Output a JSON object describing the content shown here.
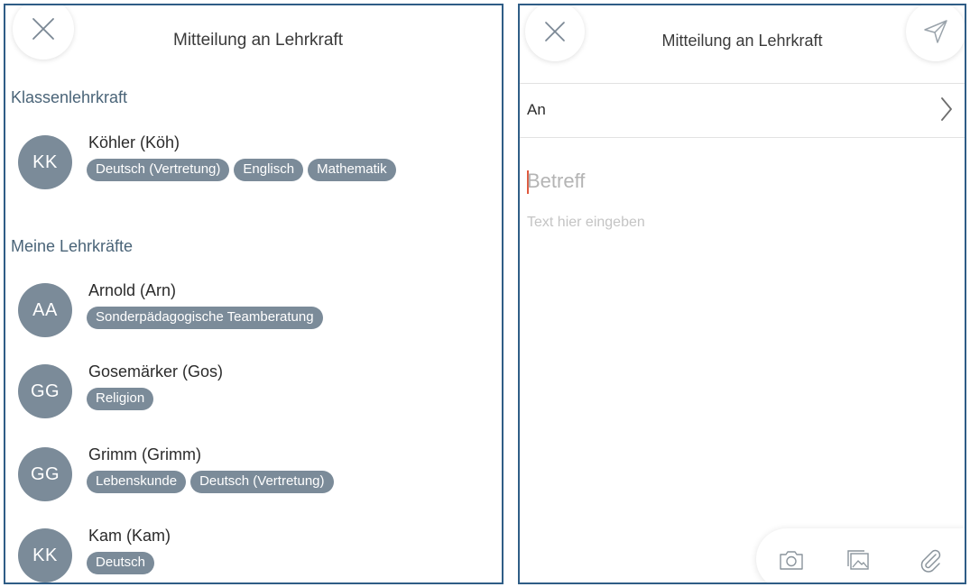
{
  "left": {
    "header": {
      "title": "Mitteilung an Lehrkraft",
      "close_icon": "close-icon"
    },
    "class_teacher_section": {
      "heading": "Klassenlehrkraft",
      "teachers": [
        {
          "initials": "KK",
          "name": "Köhler (Köh)",
          "subjects": [
            "Deutsch (Vertretung)",
            "Englisch",
            "Mathematik"
          ]
        }
      ]
    },
    "my_teachers_section": {
      "heading": "Meine Lehrkräfte",
      "teachers": [
        {
          "initials": "AA",
          "name": "Arnold (Arn)",
          "subjects": [
            "Sonderpädagogische Teamberatung"
          ]
        },
        {
          "initials": "GG",
          "name": "Gosemärker (Gos)",
          "subjects": [
            "Religion"
          ]
        },
        {
          "initials": "GG",
          "name": "Grimm (Grimm)",
          "subjects": [
            "Lebenskunde",
            "Deutsch (Vertretung)"
          ]
        },
        {
          "initials": "KK",
          "name": "Kam (Kam)",
          "subjects": [
            "Deutsch"
          ]
        }
      ]
    }
  },
  "right": {
    "header": {
      "title": "Mitteilung an Lehrkraft",
      "close_icon": "close-icon",
      "send_icon": "send-icon"
    },
    "recipient": {
      "label": "An",
      "chevron_icon": "chevron-right-icon"
    },
    "subject": {
      "placeholder": "Betreff",
      "value": ""
    },
    "body": {
      "placeholder": "Text hier eingeben",
      "value": ""
    },
    "toolbar": {
      "icons": [
        "camera-icon",
        "gallery-icon",
        "paperclip-icon"
      ]
    }
  },
  "colors": {
    "border": "#2f5d86",
    "chip": "#7b8b99",
    "cursor": "#e0583c",
    "heading": "#4a6478"
  }
}
